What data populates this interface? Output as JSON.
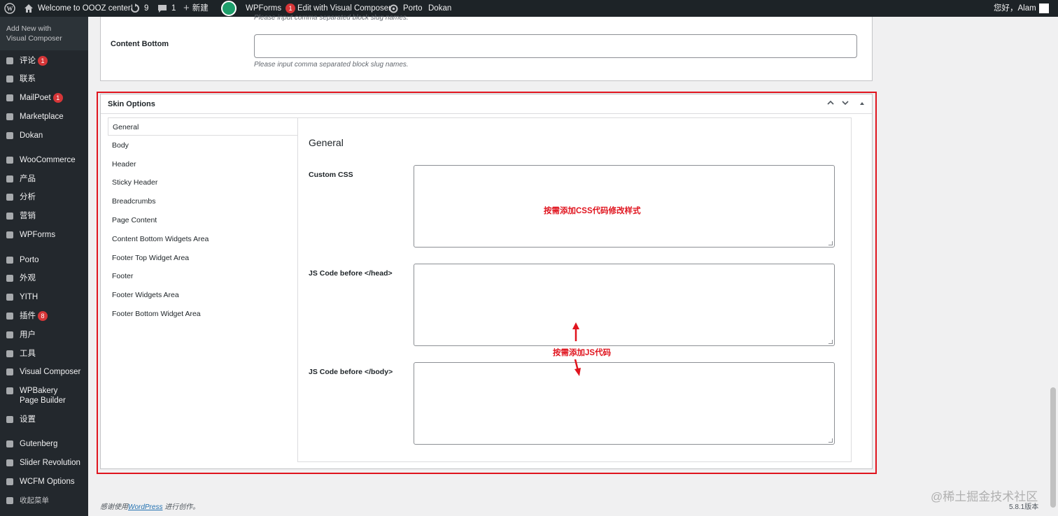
{
  "admin_bar": {
    "site_name": "Welcome to OOOZ center!",
    "updates_count": "9",
    "comments_count": "1",
    "new_label": "新建",
    "wpforms_label": "WPForms",
    "wpforms_badge": "1",
    "edit_vc_label": "Edit with Visual Composer",
    "porto_label": "Porto",
    "dokan_label": "Dokan",
    "greeting": "您好，Alam"
  },
  "sidebar": {
    "top_item": [
      "Add New with",
      "Visual Composer"
    ],
    "items": [
      {
        "label": "评论",
        "icon": "comment-icon",
        "badge": "1"
      },
      {
        "label": "联系",
        "icon": "mail-icon",
        "badge": ""
      },
      {
        "label": "MailPoet",
        "icon": "mailpoet-icon",
        "badge": "1"
      },
      {
        "label": "Marketplace",
        "icon": "marketplace-icon",
        "badge": ""
      },
      {
        "label": "Dokan",
        "icon": "dokan-icon",
        "badge": ""
      },
      {
        "label": "WooCommerce",
        "icon": "woocommerce-icon",
        "badge": ""
      },
      {
        "label": "产品",
        "icon": "archive-icon",
        "badge": ""
      },
      {
        "label": "分析",
        "icon": "chart-icon",
        "badge": ""
      },
      {
        "label": "营销",
        "icon": "megaphone-icon",
        "badge": ""
      },
      {
        "label": "WPForms",
        "icon": "forms-icon",
        "badge": ""
      },
      {
        "label": "Porto",
        "icon": "porto-icon",
        "badge": ""
      },
      {
        "label": "外观",
        "icon": "brush-icon",
        "badge": ""
      },
      {
        "label": "YITH",
        "icon": "yith-icon",
        "badge": ""
      },
      {
        "label": "插件",
        "icon": "plugin-icon",
        "badge": "8"
      },
      {
        "label": "用户",
        "icon": "user-icon",
        "badge": ""
      },
      {
        "label": "工具",
        "icon": "wrench-icon",
        "badge": ""
      },
      {
        "label": "Visual Composer",
        "icon": "visual-composer-icon",
        "badge": ""
      },
      {
        "label": "WPBakery Page Builder",
        "icon": "wpbakery-icon",
        "badge": ""
      },
      {
        "label": "设置",
        "icon": "settings-icon",
        "badge": ""
      },
      {
        "label": "Gutenberg",
        "icon": "gutenberg-icon",
        "badge": ""
      },
      {
        "label": "Slider Revolution",
        "icon": "slider-icon",
        "badge": ""
      },
      {
        "label": "WCFM Options",
        "icon": "gear-icon",
        "badge": ""
      },
      {
        "label": "收起菜单",
        "icon": "collapse-icon",
        "badge": ""
      }
    ]
  },
  "upper_panel": {
    "cut_text": "Please input comma separated block slug names.",
    "content_bottom_label": "Content Bottom",
    "content_bottom_value": "",
    "content_bottom_desc": "Please input comma separated block slug names."
  },
  "skin_options": {
    "title": "Skin Options",
    "tabs": [
      "General",
      "Body",
      "Header",
      "Sticky Header",
      "Breadcrumbs",
      "Page Content",
      "Content Bottom Widgets Area",
      "Footer Top Widget Area",
      "Footer",
      "Footer Widgets Area",
      "Footer Bottom Widget Area"
    ],
    "active_tab": "General",
    "section_title": "General",
    "fields": {
      "custom_css_label": "Custom CSS",
      "js_head_label": "JS Code before </head>",
      "js_body_label": "JS Code before </body>"
    }
  },
  "annotations": {
    "css_note": "按需添加CSS代码修改样式",
    "js_note": "按需添加JS代码"
  },
  "footer": {
    "thanks_prefix": "感谢使用",
    "wordpress_link": "WordPress",
    "thanks_suffix": "进行创作。",
    "version": "5.8.1版本",
    "watermark": "@稀土掘金技术社区"
  },
  "colors": {
    "admin_bar_bg": "#1d2327",
    "sidebar_bg": "#23282d",
    "badge": "#d63638",
    "annotation_red": "#e0141e",
    "link": "#2271b1"
  }
}
